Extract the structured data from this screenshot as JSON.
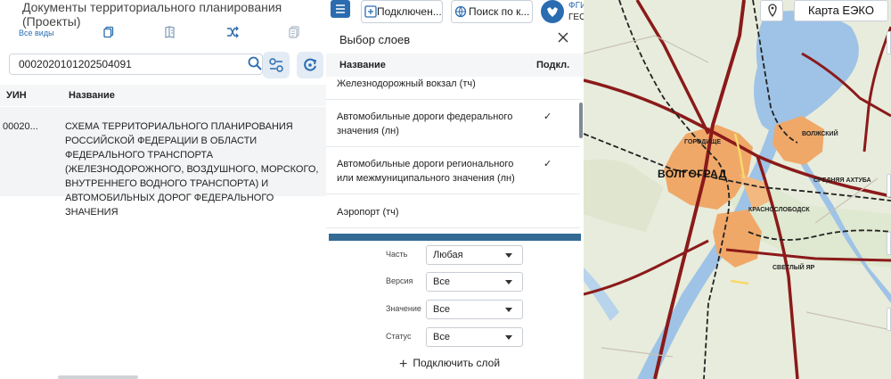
{
  "left_panel": {
    "title": "Документы территориального планирования (Проекты)",
    "all_types": "Все виды",
    "search_value": "0002020101202504091",
    "table": {
      "headers": {
        "uin": "УИН",
        "name": "Название"
      },
      "rows": [
        {
          "uin": "00020...",
          "name": "СХЕМА ТЕРРИТОРИАЛЬНОГО ПЛАНИРОВАНИЯ РОССИЙСКОЙ ФЕДЕРАЦИИ В ОБЛАСТИ ФЕДЕРАЛЬНОГО ТРАНСПОРТА (ЖЕЛЕЗНОДОРОЖНОГО, ВОЗДУШНОГО, МОРСКОГО, ВНУТРЕННЕГО ВОДНОГО ТРАНСПОРТА) И АВТОМОБИЛЬНЫХ ДОРОГ ФЕДЕРАЛЬНОГО ЗНАЧЕНИЯ"
        }
      ]
    }
  },
  "top_bar": {
    "connect_label": "Подключен...",
    "search_label": "Поиск по к...",
    "logo_line1": "ФГИС",
    "logo_line2": "ГЕО"
  },
  "layers_panel": {
    "title": "Выбор слоев",
    "col_name": "Название",
    "col_connected": "Подкл.",
    "layers": [
      {
        "name": "Железнодорожный вокзал (тч)",
        "checked": ""
      },
      {
        "name": "Автомобильные дороги федерального значения (лн)",
        "checked": "✓"
      },
      {
        "name": "Автомобильные дороги регионального или межмуниципального значения (лн)",
        "checked": "✓"
      },
      {
        "name": "Аэропорт (тч)",
        "checked": ""
      }
    ],
    "filters": [
      {
        "label": "Часть",
        "value": "Любая"
      },
      {
        "label": "Версия",
        "value": "Все"
      },
      {
        "label": "Значение",
        "value": "Все"
      },
      {
        "label": "Статус",
        "value": "Все"
      }
    ],
    "add_layer": "Подключить слой"
  },
  "map": {
    "basemap_label": "Карта ЕЭКО",
    "labels": {
      "city": "ВОЛГОГРАД",
      "volzhsky": "ВОЛЖСКИЙ",
      "gorodishche": "ГОРОДИЩЕ",
      "krasnoslobodsk": "КРАСНОСЛОБОДСК",
      "sredneakhtuba": "СРЕДНЯЯ АХТУБА",
      "svetly_yar": "СВЕТЛЫЙ ЯР"
    },
    "colors": {
      "water": "#9ec3e6",
      "urban": "#f0a868",
      "highway": "#8b1a1a",
      "railway": "#222222",
      "land": "#e8ecdc"
    }
  },
  "colors": {
    "accent": "#2b6cb0",
    "panel_blue": "#336b94"
  }
}
